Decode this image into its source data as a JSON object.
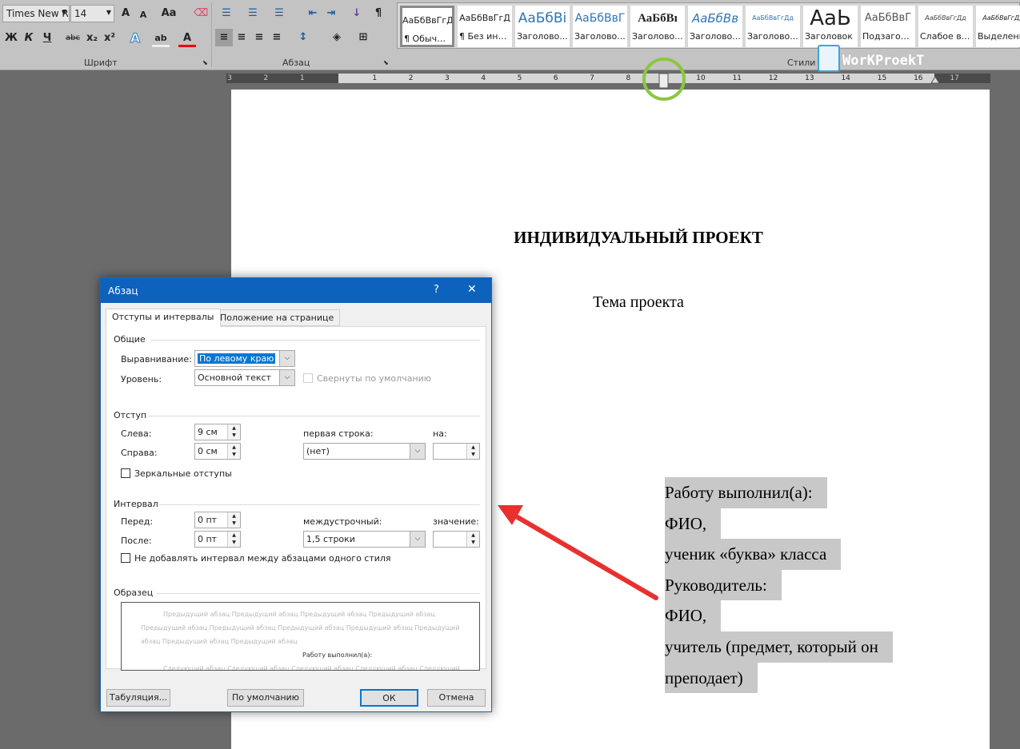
{
  "ribbon": {
    "font_name": "Times New R",
    "font_size": "14",
    "font_group_label": "Шрифт",
    "paragraph_group_label": "Абзац",
    "styles_group_label": "Стили",
    "buttons": {
      "grow": "A",
      "shrink": "A",
      "case": "Aa",
      "bold": "Ж",
      "italic": "К",
      "underline": "Ч",
      "strike": "abc",
      "sub": "x₂",
      "sup": "x²",
      "effects": "A",
      "highlight": "ab",
      "color": "A",
      "pilcrow": "¶"
    },
    "styles": [
      {
        "preview": "АаБбВвГгД",
        "name": "¶ Обычный"
      },
      {
        "preview": "АаБбВвГгД",
        "name": "¶ Без инте..."
      },
      {
        "preview": "АаБбВі",
        "name": "Заголово..."
      },
      {
        "preview": "АаБбВвГ",
        "name": "Заголово..."
      },
      {
        "preview": "АаБбВı",
        "name": "Заголово..."
      },
      {
        "preview": "АаБбВв",
        "name": "Заголово..."
      },
      {
        "preview": "АаБбВвГгДд",
        "name": "Заголово..."
      },
      {
        "preview": "АаЬ",
        "name": "Заголовок"
      },
      {
        "preview": "АаБбВвГ",
        "name": "Подзагол..."
      },
      {
        "preview": "АаБбВвГгДд",
        "name": "Слабое в..."
      },
      {
        "preview": "АаБбВвГгДд",
        "name": "Выделени"
      }
    ],
    "watermark": "WorKProekT"
  },
  "ruler": {
    "left_numbers": [
      "3",
      "2",
      "1"
    ],
    "right_numbers": [
      "1",
      "2",
      "3",
      "4",
      "5",
      "6",
      "7",
      "8",
      "9",
      "10",
      "11",
      "12",
      "13",
      "14",
      "15",
      "16",
      "17"
    ],
    "left_indent_cm": 9
  },
  "document": {
    "title": "ИНДИВИДУАЛЬНЫЙ ПРОЕКТ",
    "subtitle": "Тема проекта",
    "lines": [
      "Работу выполнил(а):",
      "ФИО,",
      "ученик «буква» класса",
      "Руководитель:",
      "ФИО,",
      "учитель (предмет, который он",
      "преподает)"
    ]
  },
  "dialog": {
    "title": "Абзац",
    "help": "?",
    "close": "✕",
    "tabs": [
      "Отступы и интервалы",
      "Положение на странице"
    ],
    "general": {
      "header": "Общие",
      "alignment_label": "Выравнивание:",
      "alignment_value": "По левому краю",
      "level_label": "Уровень:",
      "level_value": "Основной текст",
      "collapsed_label": "Свернуты по умолчанию"
    },
    "indent": {
      "header": "Отступ",
      "left_label": "Слева:",
      "left_value": "9 см",
      "right_label": "Справа:",
      "right_value": "0 см",
      "first_line_label": "первая строка:",
      "first_line_value": "(нет)",
      "by_label": "на:",
      "by_value": "",
      "mirror_label": "Зеркальные отступы"
    },
    "spacing": {
      "header": "Интервал",
      "before_label": "Перед:",
      "before_value": "0 пт",
      "after_label": "После:",
      "after_value": "0 пт",
      "line_label": "междустрочный:",
      "line_value": "1,5 строки",
      "at_label": "значение:",
      "at_value": "",
      "no_space_label": "Не добавлять интервал между абзацами одного стиля"
    },
    "preview": {
      "header": "Образец",
      "prev1": "Предыдущий абзац Предыдущий абзац Предыдущий абзац Предыдущий абзац",
      "prev2": "Предыдущий абзац Предыдущий абзац Предыдущий абзац Предыдущий абзац Предыдущий",
      "prev3": "абзац Предыдущий абзац Предыдущий абзац",
      "current": "Работу выполнил(а):",
      "next": "Следующий абзац Следующий абзац Следующий абзац Следующий абзац Следующий"
    },
    "buttons": {
      "tabs": "Табуляция...",
      "default": "По умолчанию",
      "ok": "ОК",
      "cancel": "Отмена"
    }
  },
  "colors": {
    "accent": "#0c62bd",
    "annotation_arrow": "#e8312f",
    "annotation_circle": "#8cc63f",
    "selection": "#c8c8c8"
  }
}
